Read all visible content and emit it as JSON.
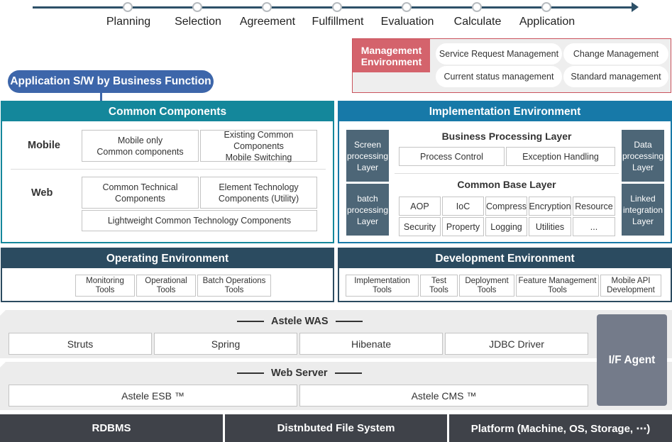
{
  "timeline": {
    "stages": [
      "Planning",
      "Selection",
      "Agreement",
      "Fulfillment",
      "Evaluation",
      "Calculate",
      "Application"
    ],
    "color": "#2d5068"
  },
  "management": {
    "title": "Management Environment",
    "items": [
      "Service Request Management",
      "Change Management",
      "Current status management",
      "Standard management"
    ],
    "color": "#d4636c"
  },
  "app_badge": "Application S/W by Business Function",
  "common_components": {
    "title": "Common Components",
    "color": "#14879b",
    "mobile": {
      "label": "Mobile",
      "items": [
        "Mobile only\nCommon components",
        "Existing Common Components\nMobile Switching"
      ]
    },
    "web": {
      "label": "Web",
      "items": [
        "Common Technical\nComponents",
        "Element Technology\nComponents (Utility)"
      ],
      "wide_item": "Lightweight Common Technology Components"
    }
  },
  "implementation": {
    "title": "Implementation Environment",
    "color": "#1779a8",
    "left_layers": [
      "Screen\nprocessing\nLayer",
      "batch\nprocessing\nLayer"
    ],
    "right_layers": [
      "Data\nprocessing\nLayer",
      "Linked\nintegration\nLayer"
    ],
    "business_layer": {
      "title": "Business Processing Layer",
      "items": [
        "Process Control",
        "Exception Handling"
      ]
    },
    "common_base_layer": {
      "title": "Common Base Layer",
      "items": [
        "AOP",
        "IoC",
        "Compress",
        "Encryption",
        "Resource",
        "Security",
        "Property",
        "Logging",
        "Utilities",
        "..."
      ]
    }
  },
  "operating": {
    "title": "Operating Environment",
    "color": "#2b4b60",
    "tools": [
      "Monitoring\nTools",
      "Operational\nTools",
      "Batch Operations\nTools"
    ]
  },
  "development": {
    "title": "Development Environment",
    "color": "#2b4b60",
    "tools": [
      "Implementation\nTools",
      "Test\nTools",
      "Deployment\nTools",
      "Feature Management\nTools",
      "Mobile API\nDevelopment"
    ]
  },
  "was": {
    "title": "Astele WAS",
    "items": [
      "Struts",
      "Spring",
      "Hibenate",
      "JDBC Driver"
    ]
  },
  "web_server": {
    "title": "Web Server",
    "items": [
      "Astele ESB ™",
      "Astele CMS ™"
    ]
  },
  "agent": "I/F Agent",
  "base": [
    "RDBMS",
    "Distnbuted File System",
    "Platform (Machine, OS, Storage, ⋯)"
  ]
}
